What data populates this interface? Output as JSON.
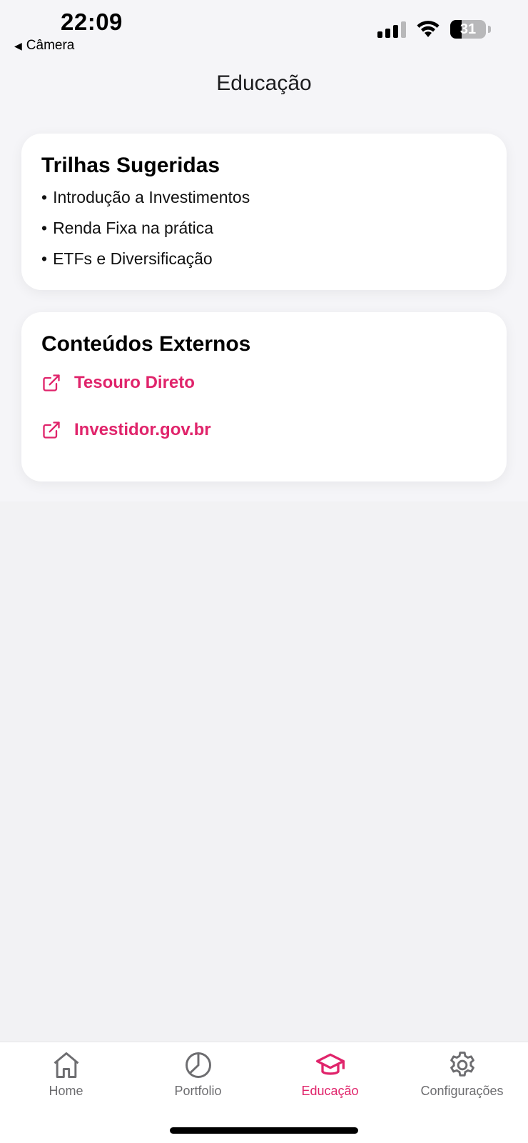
{
  "status_bar": {
    "time": "22:09",
    "back_label": "Câmera",
    "battery_level": "31",
    "signal_bars": 3
  },
  "header": {
    "title": "Educação"
  },
  "suggested_trails": {
    "title": "Trilhas Sugeridas",
    "items": [
      {
        "label": "Introdução a Investimentos"
      },
      {
        "label": "Renda Fixa na prática"
      },
      {
        "label": "ETFs e Diversificação"
      }
    ]
  },
  "external_content": {
    "title": "Conteúdos Externos",
    "links": [
      {
        "label": "Tesouro Direto",
        "icon": "external-link-icon"
      },
      {
        "label": "Investidor.gov.br",
        "icon": "external-link-icon"
      }
    ]
  },
  "tab_bar": {
    "tabs": [
      {
        "label": "Home",
        "icon": "home-icon",
        "active": false
      },
      {
        "label": "Portfolio",
        "icon": "pie-chart-icon",
        "active": false
      },
      {
        "label": "Educação",
        "icon": "graduation-cap-icon",
        "active": true
      },
      {
        "label": "Configurações",
        "icon": "gear-icon",
        "active": false
      }
    ]
  },
  "colors": {
    "accent": "#e0246b",
    "inactive": "#6d6d70",
    "background": "#f2f2f4",
    "card": "#ffffff"
  }
}
